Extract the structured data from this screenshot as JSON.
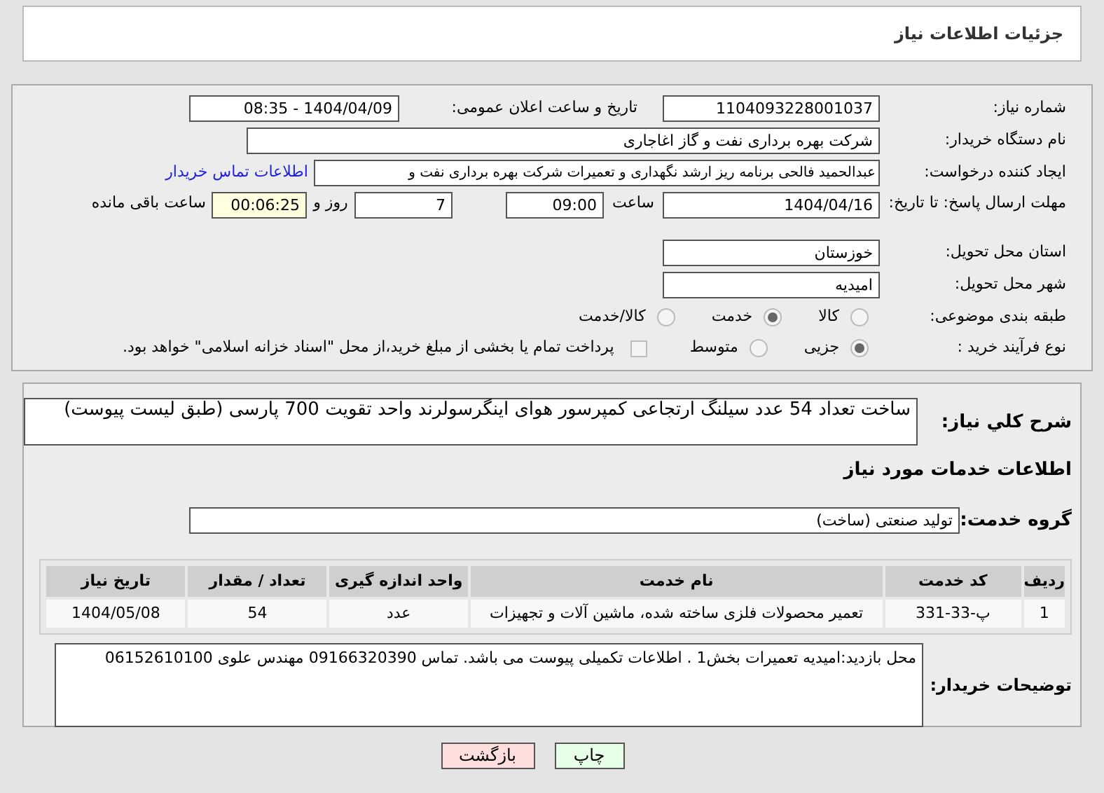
{
  "header": {
    "title": "جزئیات اطلاعات نیاز"
  },
  "form": {
    "need_number": {
      "label": "شماره نیاز:",
      "value": "1104093228001037"
    },
    "announce": {
      "label": "تاریخ و ساعت اعلان عمومی:",
      "value": "1404/04/09 - 08:35"
    },
    "buyer": {
      "label": "نام دستگاه خریدار:",
      "value": "شرکت بهره برداری نفت و گاز اغاجاری"
    },
    "creator": {
      "label": "ایجاد کننده درخواست:",
      "value": "عبدالحمید فالحی برنامه ریز ارشد نگهداری و تعمیرات شرکت بهره برداری نفت و",
      "link": "اطلاعات تماس خریدار"
    },
    "deadline": {
      "label": "مهلت ارسال پاسخ: تا تاریخ:",
      "date": "1404/04/16",
      "time_label": "ساعت",
      "time": "09:00",
      "days": "7",
      "days_label": "روز و",
      "remaining": "00:06:25",
      "remaining_label": "ساعت باقی مانده"
    },
    "province": {
      "label": "استان محل تحویل:",
      "value": "خوزستان"
    },
    "city": {
      "label": "شهر محل تحویل:",
      "value": "امیدیه"
    },
    "category": {
      "label": "طبقه بندی موضوعی:",
      "options": [
        {
          "label": "کالا",
          "selected": false
        },
        {
          "label": "خدمت",
          "selected": true
        },
        {
          "label": "کالا/خدمت",
          "selected": false
        }
      ]
    },
    "process": {
      "label": "نوع فرآیند خرید :",
      "options": [
        {
          "label": "جزیی",
          "selected": true
        },
        {
          "label": "متوسط",
          "selected": false
        }
      ],
      "payment": {
        "label": "پرداخت تمام یا بخشی از مبلغ خرید،از محل \"اسناد خزانه اسلامی\" خواهد بود.",
        "checked": false
      }
    }
  },
  "details": {
    "summary_label": "شرح كلي نياز:",
    "summary": "ساخت تعداد 54 عدد سیلنگ ارتجاعی کمپرسور هوای اینگرسولرند واحد تقویت 700 پارسی (طبق لیست پیوست)",
    "services_heading": "اطلاعات خدمات مورد نیاز",
    "group_label": "گروه خدمت:",
    "group": "تولید صنعتی (ساخت)",
    "table": {
      "columns": [
        "ردیف",
        "کد خدمت",
        "نام خدمت",
        "واحد اندازه گیری",
        "تعداد / مقدار",
        "تاریخ نیاز"
      ],
      "rows": [
        [
          "1",
          "پ-33-331",
          "تعمیر محصولات فلزی ساخته شده، ماشین آلات و تجهیزات",
          "عدد",
          "54",
          "1404/05/08"
        ]
      ]
    },
    "notes_label": "توضیحات خریدار:",
    "notes": "محل بازدید:امیدیه تعمیرات بخش1 . اطلاعات تکمیلی پیوست می باشد. تماس 09166320390 مهندس علوی 06152610100"
  },
  "buttons": [
    {
      "kind": "print",
      "label": "چاپ"
    },
    {
      "kind": "back",
      "label": "بازگشت"
    }
  ]
}
